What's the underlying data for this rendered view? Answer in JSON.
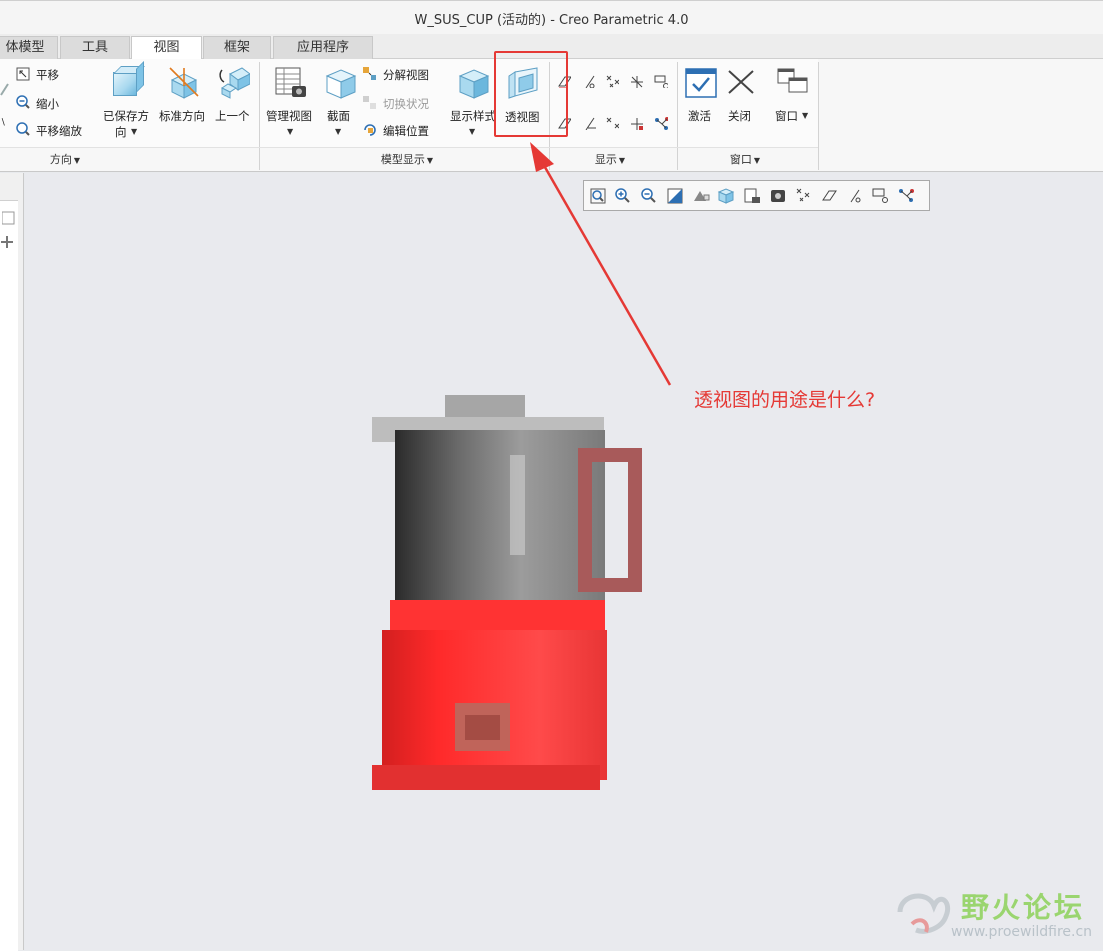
{
  "window": {
    "title": "W_SUS_CUP (活动的) - Creo Parametric 4.0"
  },
  "tabs": [
    {
      "label": "体模型",
      "active": false
    },
    {
      "label": "工具",
      "active": false
    },
    {
      "label": "视图",
      "active": true
    },
    {
      "label": "框架",
      "active": false
    },
    {
      "label": "应用程序",
      "active": false
    }
  ],
  "ribbon": {
    "orientation_group": {
      "label": "方向",
      "pan": "平移",
      "zoom_out": "缩小",
      "pan_zoom": "平移缩放",
      "saved_orientations_line1": "已保存方",
      "saved_orientations_line2": "向",
      "standard_orientation": "标准方向",
      "previous": "上一个"
    },
    "model_display_group": {
      "label": "模型显示",
      "manage_views": "管理视图",
      "section": "截面",
      "explode_view": "分解视图",
      "toggle_status": "切换状况",
      "edit_position": "编辑位置",
      "display_style": "显示样式",
      "perspective_view": "透视图"
    },
    "show_group": {
      "label": "显示"
    },
    "window_group": {
      "label": "窗口",
      "activate": "激活",
      "close": "关闭",
      "windows": "窗口"
    }
  },
  "annotation": {
    "callout_text": "透视图的用途是什么?",
    "color": "#e53935"
  },
  "watermark": {
    "name": "野火论坛",
    "url": "www.proewildfire.cn"
  }
}
